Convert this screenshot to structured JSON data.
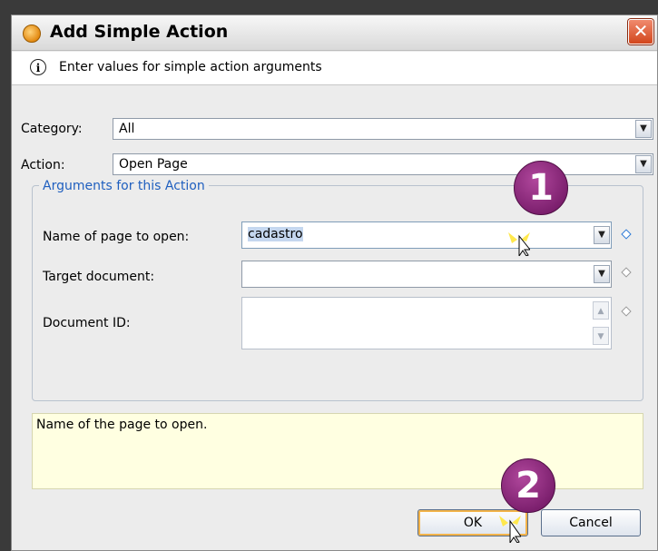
{
  "window": {
    "title": "Add Simple Action",
    "close_glyph": "✕"
  },
  "info": {
    "icon": "i",
    "text": "Enter values for simple action arguments"
  },
  "fields": {
    "category_label": "Category:",
    "category_value": "All",
    "action_label": "Action:",
    "action_value": "Open Page"
  },
  "arguments": {
    "group_title": "Arguments for this Action",
    "page_label": "Name of page to open:",
    "page_value": "cadastro",
    "target_label": "Target document:",
    "target_value": "",
    "docid_label": "Document ID:",
    "docid_value": ""
  },
  "help": {
    "text": "Name of the page to open."
  },
  "buttons": {
    "ok": "OK",
    "cancel": "Cancel"
  },
  "annotations": {
    "step1": "1",
    "step2": "2"
  },
  "colors": {
    "accent": "#1f5fbf",
    "badge": "#8b2a7e",
    "help_bg": "#ffffe1"
  }
}
